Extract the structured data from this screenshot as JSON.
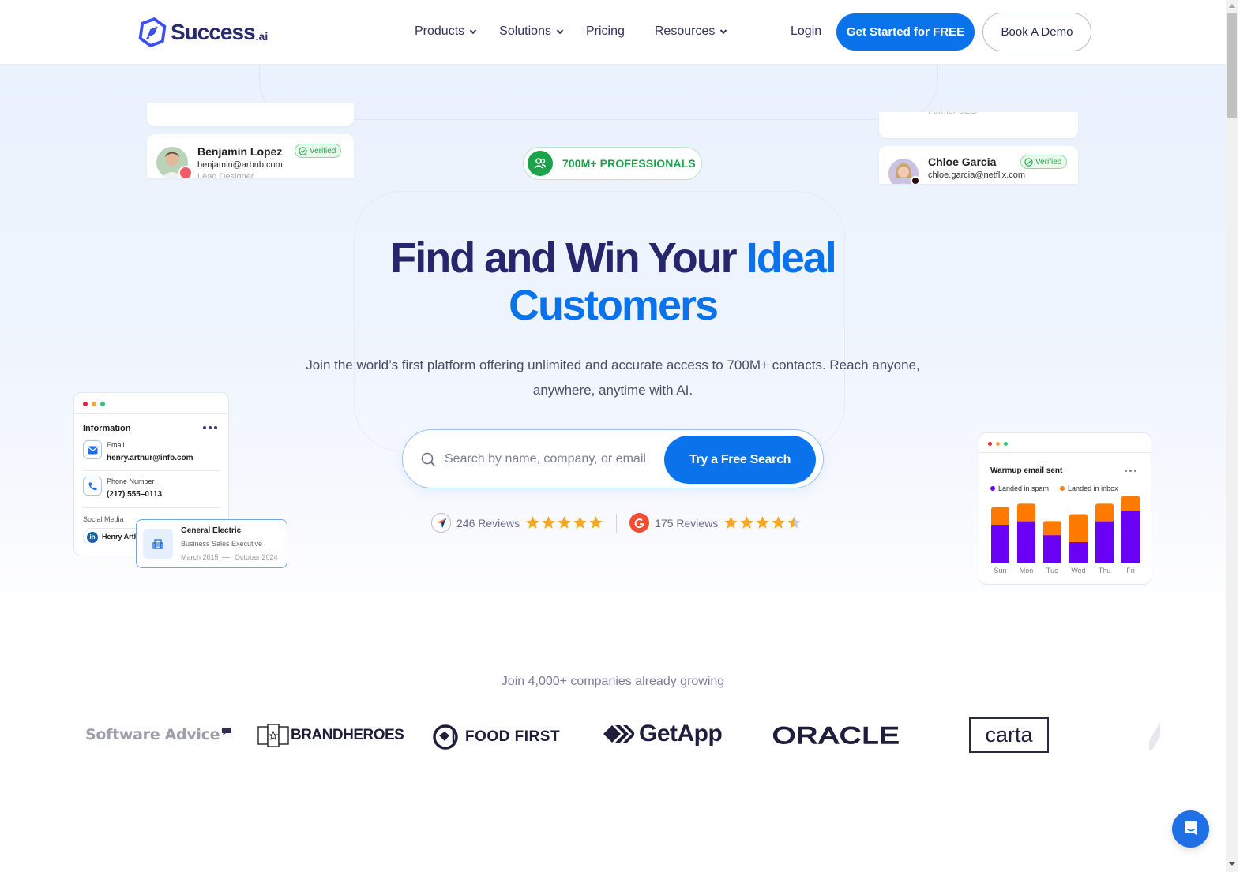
{
  "header": {
    "logo_text": "Success",
    "logo_suffix": ".ai",
    "nav": [
      {
        "label": "Products",
        "has_dropdown": true
      },
      {
        "label": "Solutions",
        "has_dropdown": true
      },
      {
        "label": "Pricing",
        "has_dropdown": false
      },
      {
        "label": "Resources",
        "has_dropdown": true
      }
    ],
    "login_label": "Login",
    "cta_primary": "Get Started for FREE",
    "cta_secondary": "Book A Demo"
  },
  "hero": {
    "badge": "700M+ PROFESSIONALS",
    "headline_part1": "Find and Win Your ",
    "headline_accent": "Ideal",
    "headline_line2": "Customers",
    "subtitle_line1": "Join the world’s first platform offering unlimited and accurate access to 700M+ contacts. Reach anyone,",
    "subtitle_line2": "anywhere, anytime with AI.",
    "search": {
      "placeholder": "Search by name, company, or email",
      "value": "",
      "button": "Try a Free Search"
    },
    "reviews": [
      {
        "source_icon": "capterra-icon",
        "label": "246 Reviews",
        "rating": 5
      },
      {
        "source_icon": "g2-icon",
        "label": "175 Reviews",
        "rating": 4.5
      }
    ]
  },
  "cards": {
    "person_left": {
      "name": "Benjamin Lopez",
      "email": "benjamin@arbnb.com",
      "role": "Lead Designer",
      "badge": "Verified"
    },
    "person_right": {
      "name": "Chloe Garcia",
      "email": "chloe.garcia@netflix.com",
      "role": "Former CEO",
      "badge": "Verified"
    },
    "info": {
      "title": "Information",
      "email_label": "Email",
      "email_value": "henry.arthur@info.com",
      "phone_label": "Phone Number",
      "phone_value": "(217) 555–0113",
      "social_label": "Social Media",
      "social_value": "Henry Arthur"
    },
    "job": {
      "company": "General Electric",
      "title": "Business Sales Executive",
      "start": "March 2015",
      "end": "October 2024"
    },
    "warmup": {
      "title": "Warmup email sent",
      "legend": [
        {
          "label": "Landed in spam",
          "color": "#6a00f4"
        },
        {
          "label": "Landed in inbox",
          "color": "#ff7a00"
        }
      ]
    }
  },
  "chart_data": {
    "type": "bar",
    "stacked": true,
    "title": "Warmup email sent",
    "categories": [
      "Sun",
      "Mon",
      "Tue",
      "Wed",
      "Thu",
      "Fri"
    ],
    "series": [
      {
        "name": "Landed in spam",
        "values": [
          44,
          48,
          32,
          24,
          48,
          60
        ]
      },
      {
        "name": "Landed in inbox",
        "values": [
          20,
          20,
          16,
          32,
          20,
          17
        ]
      }
    ],
    "ylim": [
      0,
      80
    ],
    "legend_position": "top-left",
    "grid": false
  },
  "logos": {
    "caption": "Join 4,000+ companies already growing",
    "brands": [
      "Software Advice",
      "BRANDHEROES",
      "FOOD FIRST",
      "GetApp",
      "ORACLE",
      "carta"
    ]
  },
  "colors": {
    "brand_blue": "#0a73eb",
    "navy": "#25266b",
    "green": "#1aa34a",
    "spam": "#6a00f4",
    "inbox": "#ff7a00"
  }
}
